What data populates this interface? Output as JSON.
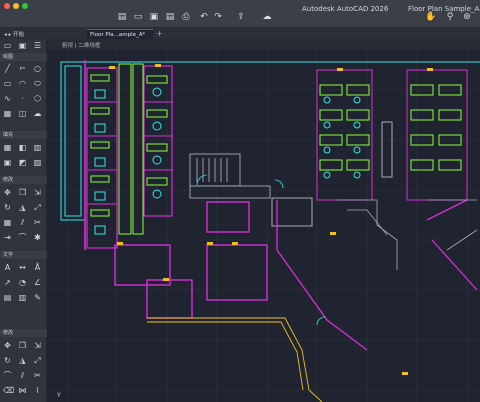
{
  "window": {
    "app_title": "Autodesk AutoCAD 2026",
    "doc_title": "Floor Plan Sample_A.dw",
    "traffic_colors": [
      "#ff5f57",
      "#febc2e",
      "#28c840"
    ]
  },
  "toolbar": {
    "icons": [
      "new-file-icon",
      "open-folder-icon",
      "save-icon",
      "save-as-icon",
      "print-icon",
      "undo-icon",
      "redo-icon",
      "share-icon",
      "cloud-icon",
      "pan-hand-icon",
      "zoom-icon",
      "orbit-icon"
    ]
  },
  "tabs": {
    "start_label": "开始",
    "file_tab_label": "Floor Pla...ample_A*",
    "new_tab_symbol": "+"
  },
  "view": {
    "label": "俯视 | 二维线框"
  },
  "palette": {
    "sections": [
      "绘图",
      "填充",
      "修改",
      "文字",
      "修改"
    ],
    "ucs_label": "Y"
  },
  "colors": {
    "wall": "#d62fd6",
    "furniture": "#2ee8e8",
    "desk": "#8cff3a",
    "tag": "#f0c020",
    "structure": "#a7adb6",
    "grid": "#2c3340"
  }
}
